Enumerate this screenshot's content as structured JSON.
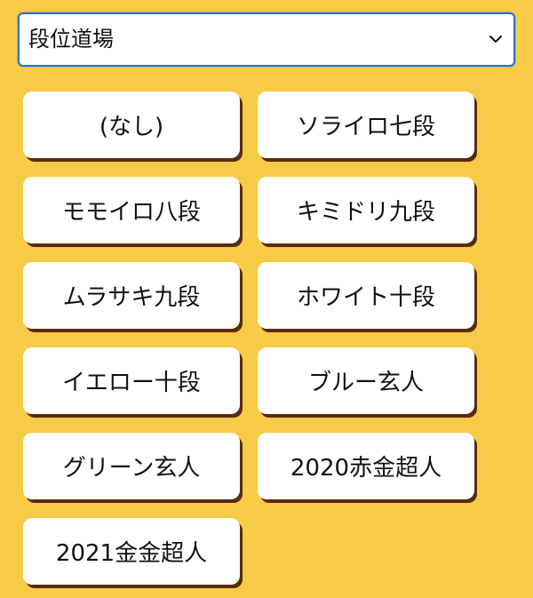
{
  "select": {
    "value": "段位道場"
  },
  "buttons": [
    {
      "label": "(なし)"
    },
    {
      "label": "ソライロ七段"
    },
    {
      "label": "モモイロ八段"
    },
    {
      "label": "キミドリ九段"
    },
    {
      "label": "ムラサキ九段"
    },
    {
      "label": "ホワイト十段"
    },
    {
      "label": "イエロー十段"
    },
    {
      "label": "ブルー玄人"
    },
    {
      "label": "グリーン玄人"
    },
    {
      "label": "2020赤金超人"
    },
    {
      "label": "2021金金超人"
    }
  ],
  "icons": {
    "dropdown": "chevron-down-icon"
  },
  "colors": {
    "background": "#f7cb45",
    "select_border": "#2f6fd0",
    "button_bg": "#ffffff",
    "button_shadow": "#5a2a0e"
  }
}
